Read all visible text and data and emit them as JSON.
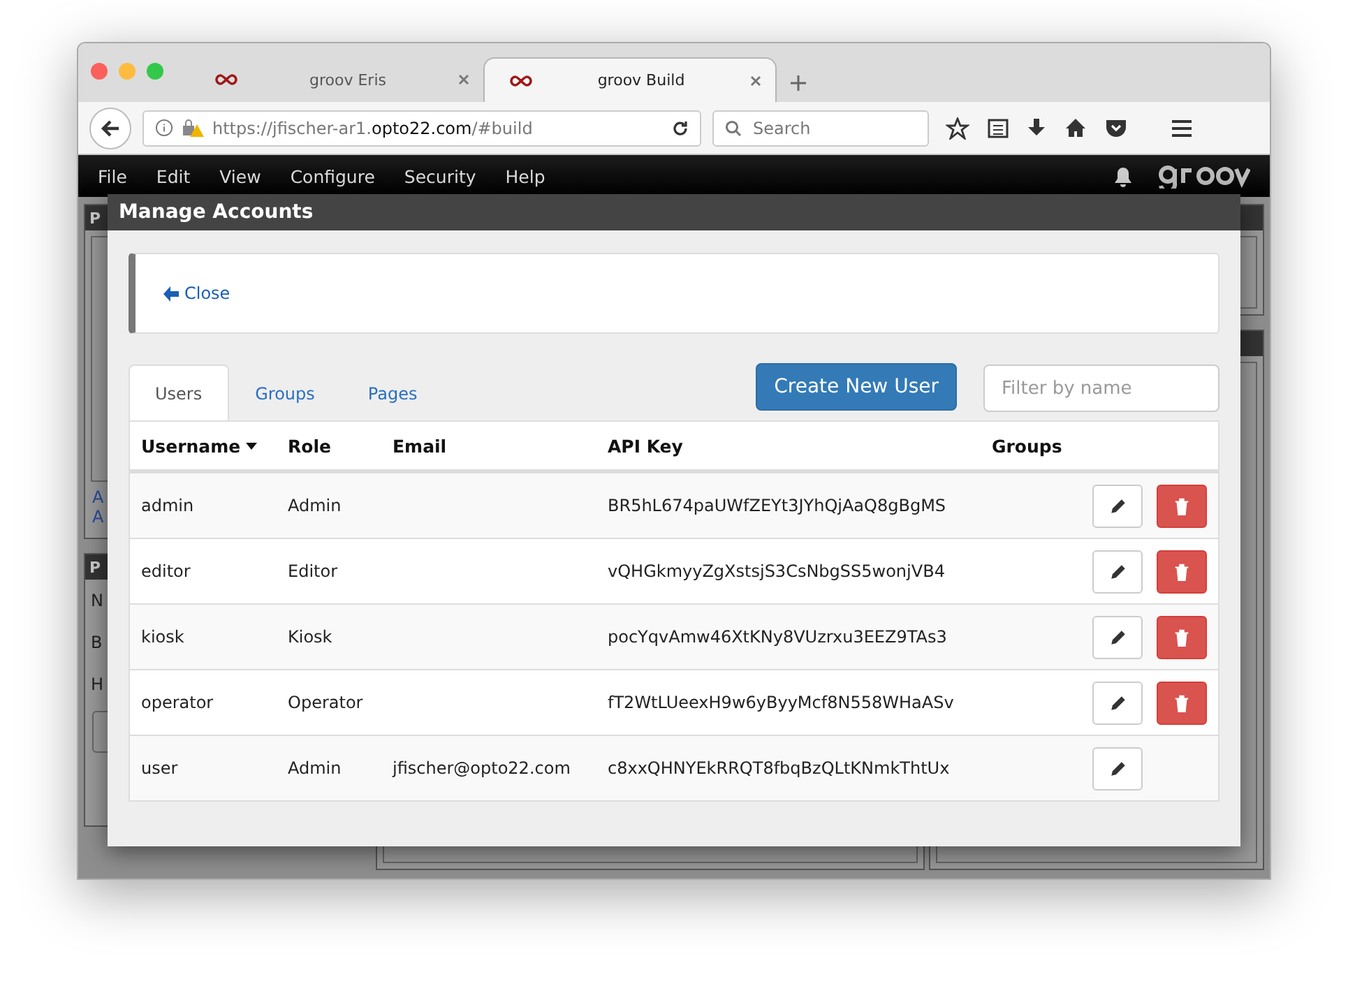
{
  "browser": {
    "tabs": [
      {
        "title": "groov Eris",
        "selected": false
      },
      {
        "title": "groov Build",
        "selected": true
      }
    ],
    "url": {
      "prefix": "https://jfischer-ar1.",
      "domain": "opto22.com",
      "path": "/#build"
    },
    "search": {
      "placeholder": "Search"
    }
  },
  "menu": [
    "File",
    "Edit",
    "View",
    "Configure",
    "Security",
    "Help"
  ],
  "background": {
    "panel_titles": [
      "P",
      "P"
    ],
    "links": [
      "A",
      "A"
    ],
    "labels": [
      "N",
      "B",
      "H"
    ]
  },
  "dialog": {
    "title": "Manage Accounts",
    "close": "Close",
    "tabs": [
      {
        "label": "Users",
        "selected": true
      },
      {
        "label": "Groups",
        "selected": false
      },
      {
        "label": "Pages",
        "selected": false
      }
    ],
    "create_button": "Create New User",
    "filter": {
      "placeholder": "Filter by name"
    },
    "columns": [
      {
        "label": "Username",
        "sorted": true
      },
      {
        "label": "Role",
        "sorted": false
      },
      {
        "label": "Email",
        "sorted": false
      },
      {
        "label": "API Key",
        "sorted": false
      },
      {
        "label": "Groups",
        "sorted": false
      }
    ],
    "rows": [
      {
        "username": "admin",
        "role": "Admin",
        "api_key": "BR5hL674paUWfZEYt3JYhQjAaQ8gBgMS",
        "deletable": true
      },
      {
        "username": "editor",
        "role": "Editor",
        "api_key": "vQHGkmyyZgXstsjS3CsNbgSS5wonjVB4",
        "deletable": true
      },
      {
        "username": "kiosk",
        "role": "Kiosk",
        "api_key": "pocYqvAmw46XtKNy8VUzrxu3EEZ9TAs3",
        "deletable": true
      },
      {
        "username": "operator",
        "role": "Operator",
        "api_key": "fT2WtLUeexH9w6yByyMcf8N558WHaASv",
        "deletable": true
      },
      {
        "username": "user",
        "role": "Admin",
        "email": "jfischer@opto22.com",
        "api_key": "c8xxQHNYEkRRQT8fbqBzQLtKNmkThtUx",
        "deletable": false
      }
    ]
  }
}
